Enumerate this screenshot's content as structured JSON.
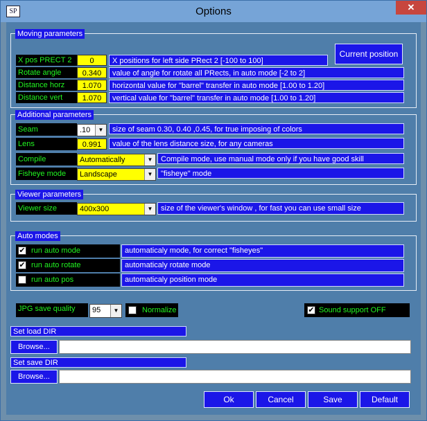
{
  "window": {
    "app_icon_text": "SP",
    "title": "Options",
    "close_glyph": "✕"
  },
  "moving": {
    "title": "Moving parameters",
    "current_position_button": "Current position",
    "rows": [
      {
        "label": "X pos PRECT 2",
        "value": "0",
        "desc": "X positions for left side PRect 2 [-100 to 100]"
      },
      {
        "label": "Rotate angle",
        "value": "0.340",
        "desc": "value of angle for rotate all PRects, in auto mode [-2 to 2]"
      },
      {
        "label": "Distance horz",
        "value": "1.070",
        "desc": "horizontal value for \"barrel\" transfer in auto mode [1.00 to 1.20]"
      },
      {
        "label": "Distance vert",
        "value": "1.070",
        "desc": "vertical value for \"barrel\" transfer in auto mode [1.00 to 1.20]"
      }
    ]
  },
  "additional": {
    "title": "Additional parameters",
    "seam": {
      "label": "Seam",
      "value": ".10",
      "desc": "size of seam 0.30, 0.40 ,0.45, for true imposing of colors"
    },
    "lens": {
      "label": "Lens",
      "value": "0.991",
      "desc": "value of the lens distance size, for any cameras"
    },
    "compile": {
      "label": "Compile",
      "value": "Automatically",
      "desc": "Compile mode, use manual mode only if you have good skill"
    },
    "fisheye": {
      "label": "Fisheye mode",
      "value": "Landscape",
      "desc": "\"fisheye\" mode"
    }
  },
  "viewer": {
    "title": "Viewer parameters",
    "size": {
      "label": "Viewer size",
      "value": "400x300",
      "desc": "size of the viewer's window , for fast you can use small size"
    }
  },
  "auto": {
    "title": "Auto modes",
    "rows": [
      {
        "label": "run auto mode",
        "checked": "✔",
        "desc": "automaticaly mode, for correct \"fisheyes\""
      },
      {
        "label": "run auto rotate",
        "checked": "✔",
        "desc": "automaticaly rotate mode"
      },
      {
        "label": "run auto pos",
        "checked": "",
        "desc": "automaticaly position mode"
      }
    ]
  },
  "bottom": {
    "jpg_label": "JPG save quality",
    "jpg_value": "95",
    "normalize_label": "Normalize",
    "normalize_checked": "",
    "sound_label": "Sound support OFF",
    "sound_checked": "✔"
  },
  "dirs": {
    "load_label": "Set load DIR",
    "save_label": "Set save DIR",
    "browse_label": "Browse...",
    "load_path": "",
    "save_path": ""
  },
  "buttons": {
    "ok": "Ok",
    "cancel": "Cancel",
    "save": "Save",
    "default": "Default"
  },
  "icons": {
    "dropdown": "chevron-down-icon",
    "check": "checkmark-icon",
    "close": "close-icon"
  }
}
